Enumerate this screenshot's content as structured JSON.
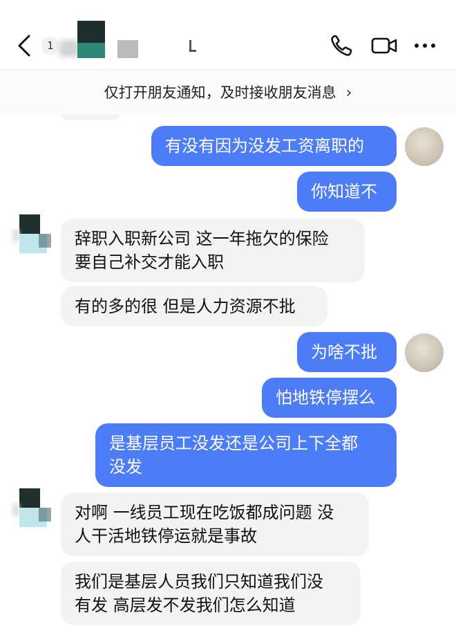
{
  "header": {
    "unread_count": "1",
    "contact_name_fragment": "[",
    "icons": {
      "back": "chevron-left-icon",
      "call": "phone-icon",
      "video": "video-camera-icon",
      "more": "more-horizontal-icon"
    }
  },
  "notify_bar": {
    "text": "仅打开朋友通知，及时接收朋友消息",
    "chevron": "›"
  },
  "messages": [
    {
      "from": "me",
      "text": "有没有因为没发工资离职的"
    },
    {
      "from": "me",
      "text": "你知道不"
    },
    {
      "from": "them",
      "text": "辞职入职新公司 这一年拖欠的保险\n要自己补交才能入职"
    },
    {
      "from": "them",
      "text": "有的多的很 但是人力资源不批"
    },
    {
      "from": "me",
      "text": "为啥不批"
    },
    {
      "from": "me",
      "text": "怕地铁停摆么"
    },
    {
      "from": "me",
      "text": "是基层员工没发还是公司上下全都\n没发"
    },
    {
      "from": "them",
      "text": "对啊 一线员工现在吃饭都成问题 没\n人干活地铁停运就是事故"
    },
    {
      "from": "them",
      "text": "我们是基层人员我们只知道我们没\n有发 高层发不发我们怎么知道"
    }
  ],
  "colors": {
    "my_bubble": "#4d7cf7",
    "their_bubble": "#f2f3f5",
    "background": "#ffffff"
  }
}
